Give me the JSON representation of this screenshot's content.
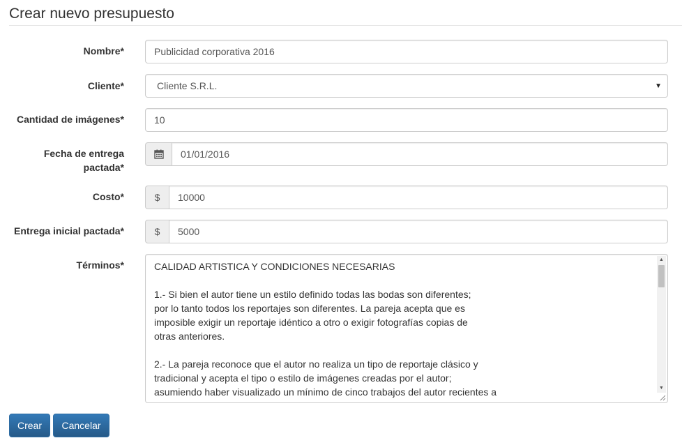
{
  "page": {
    "title": "Crear nuevo presupuesto"
  },
  "form": {
    "nombre": {
      "label": "Nombre*",
      "value": "Publicidad corporativa 2016"
    },
    "cliente": {
      "label": "Cliente*",
      "value": "Cliente S.R.L.",
      "caret": "▼"
    },
    "cantidad": {
      "label": "Cantidad de imágenes*",
      "value": "10"
    },
    "fecha": {
      "label_line1": "Fecha de entrega",
      "label_line2": "pactada*",
      "value": "01/01/2016",
      "icon": "calendar-icon"
    },
    "costo": {
      "label": "Costo*",
      "prefix": "$",
      "value": "10000"
    },
    "entrega": {
      "label": "Entrega inicial pactada*",
      "prefix": "$",
      "value": "5000"
    },
    "terminos": {
      "label": "Términos*",
      "value": "CALIDAD ARTISTICA Y CONDICIONES NECESARIAS\n\n1.- Si bien el autor tiene un estilo definido todas las bodas son diferentes;\npor lo tanto todos los reportajes son diferentes. La pareja acepta que es\nimposible exigir un reportaje idéntico a otro o exigir fotografías copias de\notras anteriores.\n\n2.- La pareja reconoce que el autor no realiza un tipo de reportaje clásico y\ntradicional y acepta el tipo o estilo de imágenes creadas por el autor;\nasumiendo haber visualizado un mínimo de cinco trabajos del autor recientes a\nla firma de este contrato, publicadas en el blog o en su pagina."
    }
  },
  "buttons": {
    "submit": "Crear",
    "cancel": "Cancelar"
  },
  "colors": {
    "primary": "#337ab7",
    "border": "#cccccc",
    "addon_bg": "#eeeeee"
  }
}
